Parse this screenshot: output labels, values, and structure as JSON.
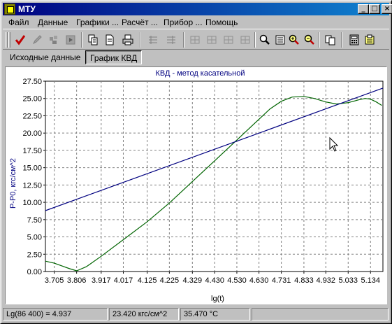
{
  "window": {
    "title": "МТУ"
  },
  "menu": [
    "Файл",
    "Данные",
    "Графики ...",
    "Расчёт ...",
    "Прибор ...",
    "Помощь"
  ],
  "toolbar": {
    "icons": [
      "check-icon",
      "edit-icon",
      "puzzle-icon",
      "play-icon",
      "copy-icon",
      "document-icon",
      "print-icon",
      "grid-add-icon",
      "grid-list-icon",
      "table1-icon",
      "table2-icon",
      "table3-icon",
      "table4-icon",
      "zoom-fit-icon",
      "list-icon",
      "zoom-in-icon",
      "zoom-out-icon",
      "copy-pages-icon",
      "calculator-icon",
      "export-icon"
    ]
  },
  "tabs": [
    {
      "label": "Исходные данные",
      "active": false
    },
    {
      "label": "График КВД",
      "active": true
    }
  ],
  "status": [
    "Lg(86 400) = 4.937",
    "23.420 кгс/см^2",
    "35.470 °C"
  ],
  "chart_data": {
    "type": "line",
    "title": "КВД - метод касательной",
    "xlabel": "lg(t)",
    "ylabel": "P-P0, кгс/см^2",
    "x_ticks": [
      "3.705",
      "3.806",
      "3.917",
      "4.017",
      "4.125",
      "4.225",
      "4.329",
      "4.430",
      "4.530",
      "4.630",
      "4.731",
      "4.833",
      "4.932",
      "5.033",
      "5.134"
    ],
    "y_ticks": [
      "0.00",
      "2.50",
      "5.00",
      "7.50",
      "10.00",
      "12.50",
      "15.00",
      "17.50",
      "20.00",
      "22.50",
      "25.00",
      "27.50"
    ],
    "xlim": [
      3.665,
      5.19
    ],
    "ylim": [
      0,
      27.5
    ],
    "grid": true,
    "colors": {
      "data": "#006400",
      "tangent": "#000080",
      "title": "#000080",
      "ylabel": "#000080"
    },
    "series": [
      {
        "color": "#006400",
        "x": [
          3.665,
          3.705,
          3.74,
          3.775,
          3.806,
          3.85,
          3.917,
          4.017,
          4.125,
          4.225,
          4.329,
          4.43,
          4.53,
          4.63,
          4.68,
          4.731,
          4.78,
          4.833,
          4.88,
          4.932,
          4.98,
          5.033,
          5.08,
          5.11,
          5.134,
          5.16,
          5.185
        ],
        "y": [
          1.5,
          1.2,
          0.8,
          0.4,
          0.1,
          0.7,
          2.2,
          4.6,
          7.2,
          9.9,
          13.0,
          16.0,
          19.0,
          22.0,
          23.5,
          24.6,
          25.2,
          25.3,
          25.0,
          24.5,
          24.2,
          24.4,
          24.8,
          25.0,
          24.9,
          24.5,
          24.0
        ]
      },
      {
        "color": "#000080",
        "x": [
          3.665,
          5.19
        ],
        "y": [
          8.8,
          26.5
        ]
      }
    ]
  }
}
